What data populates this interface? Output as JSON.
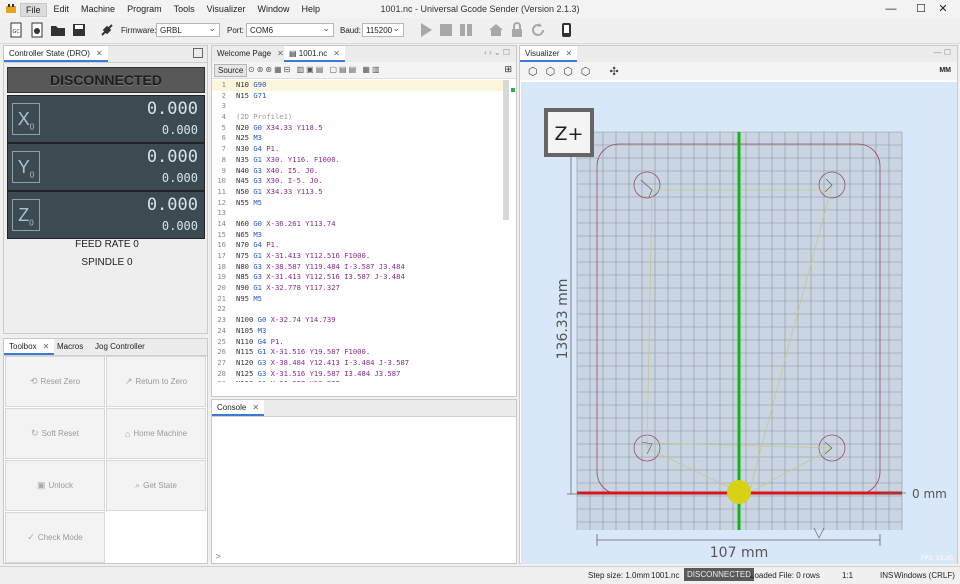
{
  "window": {
    "title": "1001.nc - Universal Gcode Sender (Version 2.1.3)",
    "menu": [
      "File",
      "Edit",
      "Machine",
      "Program",
      "Tools",
      "Visualizer",
      "Window",
      "Help"
    ],
    "min": "—",
    "max": "☐",
    "close": "✕"
  },
  "toolbar": {
    "firmware_label": "Firmware:",
    "firmware_value": "GRBL",
    "port_label": "Port:",
    "port_value": "COM6",
    "baud_label": "Baud:",
    "baud_value": "115200"
  },
  "dro": {
    "tab": "Controller State (DRO)",
    "status": "DISCONNECTED",
    "axes": [
      {
        "name": "X",
        "sub": "0",
        "machine": "0.000",
        "work": "0.000"
      },
      {
        "name": "Y",
        "sub": "0",
        "machine": "0.000",
        "work": "0.000"
      },
      {
        "name": "Z",
        "sub": "0",
        "machine": "0.000",
        "work": "0.000"
      }
    ],
    "feed_rate_label": "FEED RATE",
    "feed_rate_value": "0",
    "spindle_label": "SPINDLE",
    "spindle_value": "0"
  },
  "toolbox": {
    "tabs": [
      "Toolbox",
      "Macros",
      "Jog Controller"
    ],
    "buttons": [
      "Reset Zero",
      "Return to Zero",
      "Soft Reset",
      "Home Machine",
      "Unlock",
      "Get State",
      "Check Mode"
    ]
  },
  "editor": {
    "tabs": [
      "Welcome Page",
      "1001.nc"
    ],
    "source_label": "Source",
    "lines": [
      [
        {
          "t": "N10 ",
          "c": "kn"
        },
        {
          "t": "G90",
          "c": "kg"
        }
      ],
      [
        {
          "t": "N15 ",
          "c": "kn"
        },
        {
          "t": "G71",
          "c": "kg"
        }
      ],
      [],
      [
        {
          "t": "(2D Profile1)",
          "c": "kc"
        }
      ],
      [
        {
          "t": "N20 ",
          "c": "kn"
        },
        {
          "t": "G0 ",
          "c": "kg"
        },
        {
          "t": "X34.33 Y118.5",
          "c": "kp"
        }
      ],
      [
        {
          "t": "N25 ",
          "c": "kn"
        },
        {
          "t": "M3",
          "c": "km"
        }
      ],
      [
        {
          "t": "N30 ",
          "c": "kn"
        },
        {
          "t": "G4 ",
          "c": "kg"
        },
        {
          "t": "P1.",
          "c": "kp"
        }
      ],
      [
        {
          "t": "N35 ",
          "c": "kn"
        },
        {
          "t": "G1 ",
          "c": "kg"
        },
        {
          "t": "X30. Y116. F1000.",
          "c": "kp"
        }
      ],
      [
        {
          "t": "N40 ",
          "c": "kn"
        },
        {
          "t": "G3 ",
          "c": "kg"
        },
        {
          "t": "X40. I5. J0.",
          "c": "kp"
        }
      ],
      [
        {
          "t": "N45 ",
          "c": "kn"
        },
        {
          "t": "G3 ",
          "c": "kg"
        },
        {
          "t": "X30. I-5. J0.",
          "c": "kp"
        }
      ],
      [
        {
          "t": "N50 ",
          "c": "kn"
        },
        {
          "t": "G1 ",
          "c": "kg"
        },
        {
          "t": "X34.33 Y113.5",
          "c": "kp"
        }
      ],
      [
        {
          "t": "N55 ",
          "c": "kn"
        },
        {
          "t": "M5",
          "c": "km"
        }
      ],
      [],
      [
        {
          "t": "N60 ",
          "c": "kn"
        },
        {
          "t": "G0 ",
          "c": "kg"
        },
        {
          "t": "X-36.261 Y113.74",
          "c": "kp"
        }
      ],
      [
        {
          "t": "N65 ",
          "c": "kn"
        },
        {
          "t": "M3",
          "c": "km"
        }
      ],
      [
        {
          "t": "N70 ",
          "c": "kn"
        },
        {
          "t": "G4 ",
          "c": "kg"
        },
        {
          "t": "P1.",
          "c": "kp"
        }
      ],
      [
        {
          "t": "N75 ",
          "c": "kn"
        },
        {
          "t": "G1 ",
          "c": "kg"
        },
        {
          "t": "X-31.413 Y112.516 F1000.",
          "c": "kp"
        }
      ],
      [
        {
          "t": "N80 ",
          "c": "kn"
        },
        {
          "t": "G3 ",
          "c": "kg"
        },
        {
          "t": "X-38.587 Y119.484 I-3.587 J3.484",
          "c": "kp"
        }
      ],
      [
        {
          "t": "N85 ",
          "c": "kn"
        },
        {
          "t": "G3 ",
          "c": "kg"
        },
        {
          "t": "X-31.413 Y112.516 I3.587 J-3.484",
          "c": "kp"
        }
      ],
      [
        {
          "t": "N90 ",
          "c": "kn"
        },
        {
          "t": "G1 ",
          "c": "kg"
        },
        {
          "t": "X-32.778 Y117.327",
          "c": "kp"
        }
      ],
      [
        {
          "t": "N95 ",
          "c": "kn"
        },
        {
          "t": "M5",
          "c": "km"
        }
      ],
      [],
      [
        {
          "t": "N100 ",
          "c": "kn"
        },
        {
          "t": "G0 ",
          "c": "kg"
        },
        {
          "t": "X-32.74 Y14.739",
          "c": "kp"
        }
      ],
      [
        {
          "t": "N105 ",
          "c": "kn"
        },
        {
          "t": "M3",
          "c": "km"
        }
      ],
      [
        {
          "t": "N110 ",
          "c": "kn"
        },
        {
          "t": "G4 ",
          "c": "kg"
        },
        {
          "t": "P1.",
          "c": "kp"
        }
      ],
      [
        {
          "t": "N115 ",
          "c": "kn"
        },
        {
          "t": "G1 ",
          "c": "kg"
        },
        {
          "t": "X-31.516 Y19.587 F1000.",
          "c": "kp"
        }
      ],
      [
        {
          "t": "N120 ",
          "c": "kn"
        },
        {
          "t": "G3 ",
          "c": "kg"
        },
        {
          "t": "X-38.484 Y12.413 I-3.484 J-3.587",
          "c": "kp"
        }
      ],
      [
        {
          "t": "N125 ",
          "c": "kn"
        },
        {
          "t": "G3 ",
          "c": "kg"
        },
        {
          "t": "X-31.516 Y19.587 I3.484 J3.587",
          "c": "kp"
        }
      ],
      [
        {
          "t": "N130 ",
          "c": "kn"
        },
        {
          "t": "G1 ",
          "c": "kg"
        },
        {
          "t": "X-36.327 Y18.222",
          "c": "kp"
        }
      ]
    ]
  },
  "console": {
    "tab": "Console",
    "prompt": ">"
  },
  "visualizer": {
    "tab": "Visualizer",
    "view_label": "Z+",
    "height_dim": "136.33 mm",
    "width_dim": "107 mm",
    "zero_dim": "0 mm",
    "fps": "FPS: 10.00",
    "mm_toggle": "MM"
  },
  "status": {
    "step_size": "Step size: 1.0mm",
    "file": "1001.nc",
    "state": "DISCONNECTED",
    "loaded": "Loaded File: 0 rows",
    "ratio": "1:1",
    "ins": "INS",
    "eol": "Windows (CRLF)"
  }
}
